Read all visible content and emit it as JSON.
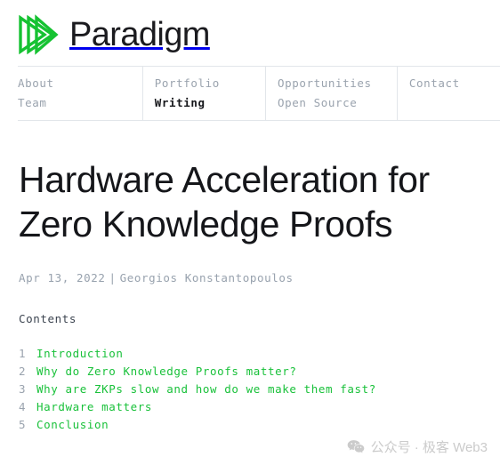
{
  "brand": {
    "name": "Paradigm",
    "logo_icon": "paradigm-prism-logo-icon",
    "logo_color": "#16c232"
  },
  "nav": {
    "columns": [
      {
        "items": [
          {
            "label": "About",
            "active": false
          },
          {
            "label": "Team",
            "active": false
          }
        ]
      },
      {
        "items": [
          {
            "label": "Portfolio",
            "active": false
          },
          {
            "label": "Writing",
            "active": true
          }
        ]
      },
      {
        "items": [
          {
            "label": "Opportunities",
            "active": false
          },
          {
            "label": "Open Source",
            "active": false
          }
        ]
      },
      {
        "items": [
          {
            "label": "Contact",
            "active": false
          }
        ]
      }
    ]
  },
  "article": {
    "title": "Hardware Acceleration for Zero Knowledge Proofs",
    "date": "Apr 13, 2022",
    "meta_separator": "|",
    "author": "Georgios Konstantopoulos",
    "contents_label": "Contents",
    "toc": [
      {
        "num": "1",
        "label": "Introduction"
      },
      {
        "num": "2",
        "label": "Why do Zero Knowledge Proofs matter?"
      },
      {
        "num": "3",
        "label": "Why are ZKPs slow and how do we make them fast?"
      },
      {
        "num": "4",
        "label": "Hardware matters"
      },
      {
        "num": "5",
        "label": "Conclusion"
      }
    ],
    "link_color": "#19c13a"
  },
  "watermark": {
    "icon": "wechat-icon",
    "text": "公众号 · 极客 Web3",
    "color": "#cbcbcb"
  }
}
